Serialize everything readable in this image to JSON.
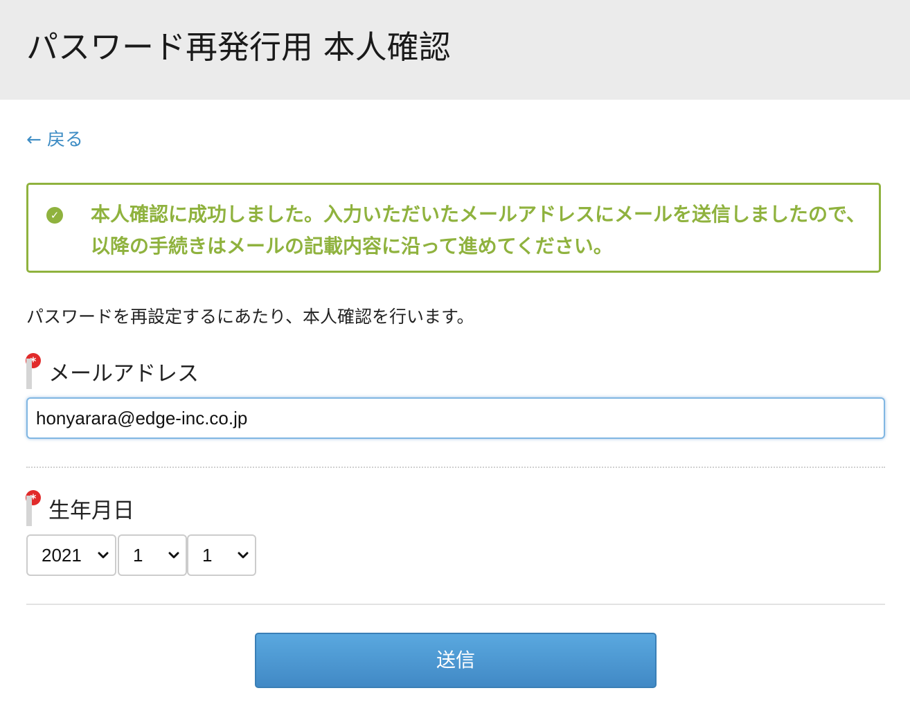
{
  "header": {
    "title": "パスワード再発行用 本人確認"
  },
  "nav": {
    "back_label": "← 戻る"
  },
  "alert": {
    "icon": "check-circle-icon",
    "message": "本人確認に成功しました。入力いただいたメールアドレスにメールを送信しましたので、以降の手続きはメールの記載内容に沿って進めてください。",
    "color": "#8fb23e"
  },
  "intro": "パスワードを再設定するにあたり、本人確認を行います。",
  "form": {
    "required_mark": "*",
    "email": {
      "label": "メールアドレス",
      "value": "honyarara@edge-inc.co.jp"
    },
    "birthdate": {
      "label": "生年月日",
      "year": "2021",
      "month": "1",
      "day": "1"
    },
    "submit_label": "送信"
  },
  "colors": {
    "link": "#3d8cc4",
    "required": "#e12b2b",
    "button": "#4a95d1"
  }
}
